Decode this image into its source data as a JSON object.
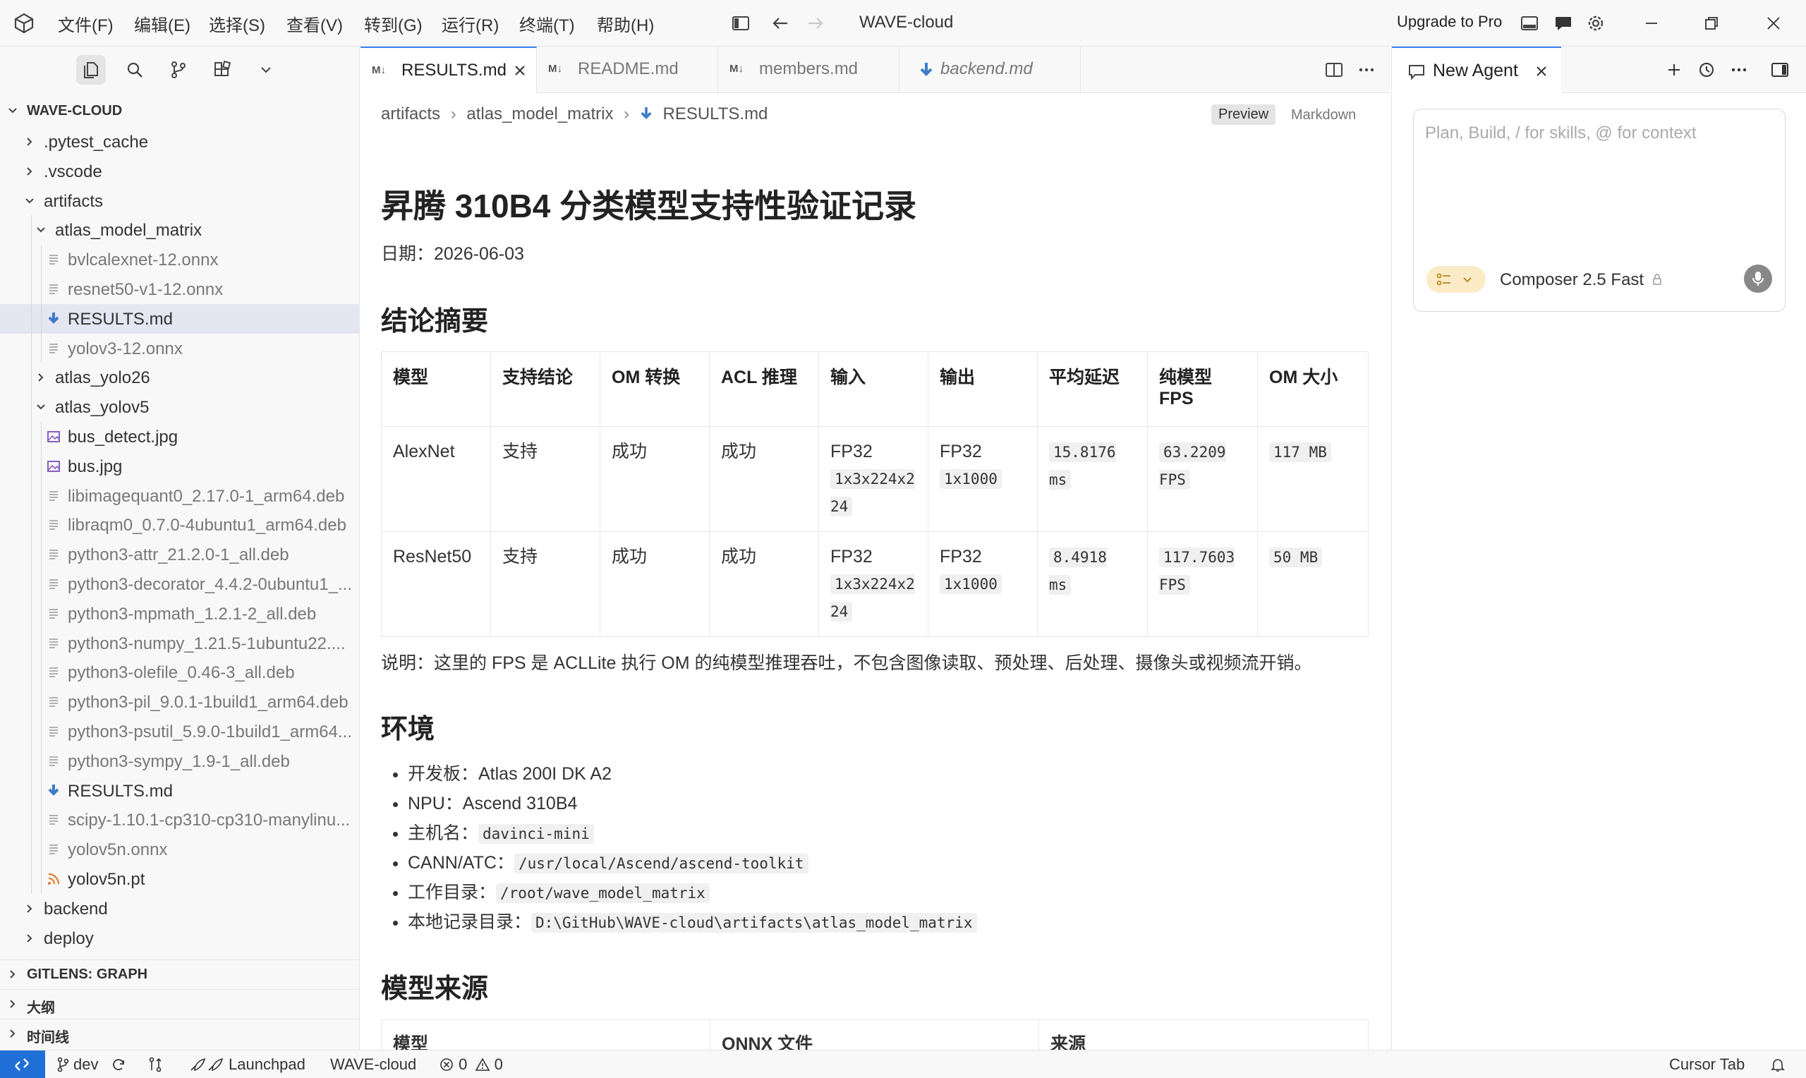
{
  "titlebar": {
    "menus": [
      "文件(F)",
      "编辑(E)",
      "选择(S)",
      "查看(V)",
      "转到(G)",
      "运行(R)",
      "终端(T)",
      "帮助(H)"
    ],
    "title": "WAVE-cloud",
    "upgrade_label": "Upgrade to Pro"
  },
  "explorer": {
    "root_label": "WAVE-CLOUD",
    "items": [
      {
        "label": ".pytest_cache",
        "indent": 1,
        "kind": "folder-closed"
      },
      {
        "label": ".vscode",
        "indent": 1,
        "kind": "folder-closed"
      },
      {
        "label": "artifacts",
        "indent": 1,
        "kind": "folder-open"
      },
      {
        "label": "atlas_model_matrix",
        "indent": 2,
        "kind": "folder-open"
      },
      {
        "label": "bvlcalexnet-12.onnx",
        "indent": 3,
        "kind": "file"
      },
      {
        "label": "resnet50-v1-12.onnx",
        "indent": 3,
        "kind": "file"
      },
      {
        "label": "RESULTS.md",
        "indent": 3,
        "kind": "markdown"
      },
      {
        "label": "yolov3-12.onnx",
        "indent": 3,
        "kind": "file"
      },
      {
        "label": "atlas_yolo26",
        "indent": 2,
        "kind": "folder-closed"
      },
      {
        "label": "atlas_yolov5",
        "indent": 2,
        "kind": "folder-open"
      },
      {
        "label": "bus_detect.jpg",
        "indent": 3,
        "kind": "image"
      },
      {
        "label": "bus.jpg",
        "indent": 3,
        "kind": "image"
      },
      {
        "label": "libimagequant0_2.17.0-1_arm64.deb",
        "indent": 3,
        "kind": "file"
      },
      {
        "label": "libraqm0_0.7.0-4ubuntu1_arm64.deb",
        "indent": 3,
        "kind": "file"
      },
      {
        "label": "python3-attr_21.2.0-1_all.deb",
        "indent": 3,
        "kind": "file"
      },
      {
        "label": "python3-decorator_4.4.2-0ubuntu1_...",
        "indent": 3,
        "kind": "file"
      },
      {
        "label": "python3-mpmath_1.2.1-2_all.deb",
        "indent": 3,
        "kind": "file"
      },
      {
        "label": "python3-numpy_1.21.5-1ubuntu22....",
        "indent": 3,
        "kind": "file"
      },
      {
        "label": "python3-olefile_0.46-3_all.deb",
        "indent": 3,
        "kind": "file"
      },
      {
        "label": "python3-pil_9.0.1-1build1_arm64.deb",
        "indent": 3,
        "kind": "file"
      },
      {
        "label": "python3-psutil_5.9.0-1build1_arm64...",
        "indent": 3,
        "kind": "file"
      },
      {
        "label": "python3-sympy_1.9-1_all.deb",
        "indent": 3,
        "kind": "file"
      },
      {
        "label": "RESULTS.md",
        "indent": 3,
        "kind": "markdown"
      },
      {
        "label": "scipy-1.10.1-cp310-cp310-manylinu...",
        "indent": 3,
        "kind": "file"
      },
      {
        "label": "yolov5n.onnx",
        "indent": 3,
        "kind": "file"
      },
      {
        "label": "yolov5n.pt",
        "indent": 3,
        "kind": "rss"
      },
      {
        "label": "backend",
        "indent": 1,
        "kind": "folder-closed"
      },
      {
        "label": "deploy",
        "indent": 1,
        "kind": "folder-closed"
      }
    ],
    "sections": [
      "GITLENS: GRAPH",
      "大纲",
      "时间线"
    ]
  },
  "tabs": [
    {
      "label": "RESULTS.md",
      "active": true
    },
    {
      "label": "README.md",
      "active": false
    },
    {
      "label": "members.md",
      "active": false
    },
    {
      "label": "backend.md",
      "active": false
    }
  ],
  "breadcrumb": {
    "parts": [
      "artifacts",
      "atlas_model_matrix",
      "RESULTS.md"
    ],
    "preview_label": "Preview",
    "markdown_label": "Markdown"
  },
  "document": {
    "title": "昇腾 310B4 分类模型支持性验证记录",
    "date": "日期：2026-06-03",
    "h_summary": "结论摘要",
    "table": {
      "headers": [
        "模型",
        "支持结论",
        "OM 转换",
        "ACL 推理",
        "输入",
        "输出",
        "平均延迟",
        "纯模型 FPS",
        "OM 大小"
      ],
      "rows": [
        {
          "model": "AlexNet",
          "support": "支持",
          "om": "成功",
          "acl": "成功",
          "in_type": "FP32",
          "in_shape": "1x3x224x224",
          "out_type": "FP32",
          "out_shape": "1x1000",
          "latency": "15.8176 ms",
          "fps": "63.2209 FPS",
          "size": "117 MB"
        },
        {
          "model": "ResNet50",
          "support": "支持",
          "om": "成功",
          "acl": "成功",
          "in_type": "FP32",
          "in_shape": "1x3x224x224",
          "out_type": "FP32",
          "out_shape": "1x1000",
          "latency": "8.4918 ms",
          "fps": "117.7603 FPS",
          "size": "50 MB"
        }
      ]
    },
    "note": "说明：这里的 FPS 是 ACLLite 执行 OM 的纯模型推理吞吐，不包含图像读取、预处理、后处理、摄像头或视频流开销。",
    "h_env": "环境",
    "env": [
      {
        "label": "开发板：Atlas 200I DK A2",
        "code": ""
      },
      {
        "label": "NPU：Ascend 310B4",
        "code": ""
      },
      {
        "label": "主机名：",
        "code": "davinci-mini"
      },
      {
        "label": "CANN/ATC：",
        "code": "/usr/local/Ascend/ascend-toolkit"
      },
      {
        "label": "工作目录：",
        "code": "/root/wave_model_matrix"
      },
      {
        "label": "本地记录目录：",
        "code": "D:\\GitHub\\WAVE-cloud\\artifacts\\atlas_model_matrix"
      }
    ],
    "h_source": "模型来源",
    "source_headers": [
      "模型",
      "ONNX 文件",
      "来源"
    ]
  },
  "agent": {
    "tab_label": "New Agent",
    "placeholder": "Plan, Build, / for skills, @ for context",
    "composer_label": "Composer 2.5 Fast"
  },
  "statusbar": {
    "branch": "dev",
    "launchpad": "Launchpad",
    "workspace": "WAVE-cloud",
    "errors": "0",
    "warnings": "0",
    "cursor_tab": "Cursor Tab"
  },
  "colors": {
    "accent": "#3b82f6",
    "remote": "#1f6fd6",
    "markdown_icon": "#3d7cc9",
    "rss_icon": "#e87a2f",
    "image_icon": "#8a5cc2"
  }
}
